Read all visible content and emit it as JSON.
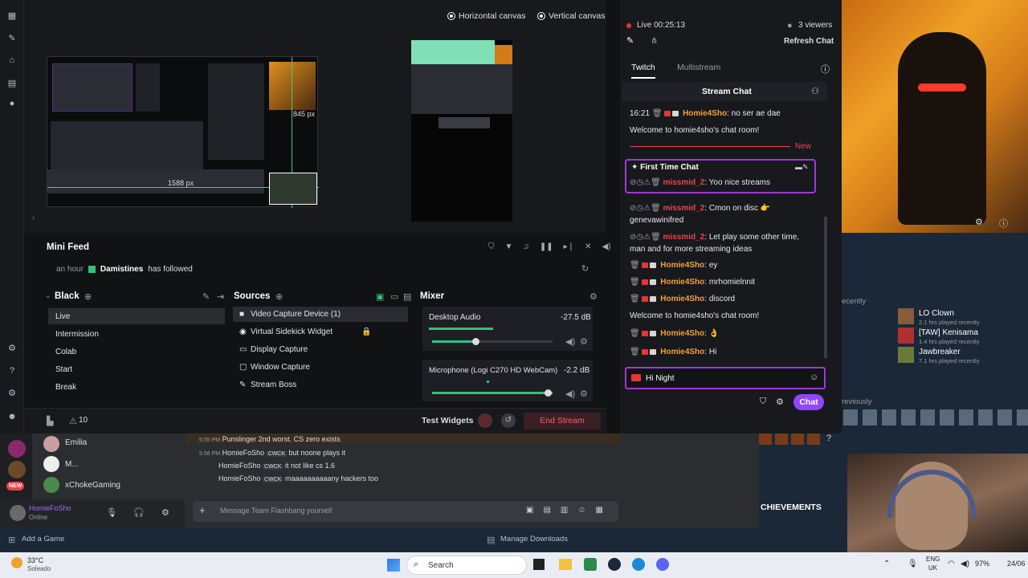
{
  "preview": {
    "canvas_horizontal": "Horizontal canvas",
    "canvas_vertical": "Vertical canvas",
    "measure_h": "845 px",
    "measure_w": "1588 px"
  },
  "minifeed": {
    "title": "Mini Feed",
    "time": "an hour",
    "user": "Damistines",
    "action": "has followed"
  },
  "scenes": {
    "title": "Black",
    "items": [
      "Live",
      "Intermission",
      "Colab",
      "Start",
      "Break"
    ]
  },
  "sources": {
    "title": "Sources",
    "items": [
      "Video Capture Device (1)",
      "Virtual Sidekick Widget",
      "Display Capture",
      "Window Capture",
      "Stream Boss"
    ]
  },
  "mixer": {
    "title": "Mixer",
    "channels": [
      {
        "name": "Desktop Audio",
        "db": "-27.5 dB",
        "level": 0.55
      },
      {
        "name": "Microphone (Logi C270 HD WebCam)",
        "db": "-2.2 dB",
        "level": 0.05
      }
    ]
  },
  "statusbar": {
    "alerts": "10",
    "test_widgets": "Test Widgets",
    "end_stream": "End Stream"
  },
  "chat": {
    "live_time": "Live 00:25:13",
    "viewers": "3 viewers",
    "refresh": "Refresh Chat",
    "tabs": [
      "Twitch",
      "Multistream"
    ],
    "header": "Stream Chat",
    "new_label": "New",
    "first_time_label": "First Time Chat",
    "input_value": "Hi Night",
    "send_label": "Chat",
    "messages": [
      {
        "time": "16:21",
        "user": "Homie4Sho",
        "text": "no ser ae dae"
      },
      {
        "system": "Welcome to homie4sho's chat room!"
      },
      {
        "user": "missmid_2",
        "text": "Yoo nice streams"
      },
      {
        "user": "missmid_2",
        "text": "Cmon on disc 👉 genevawinifred"
      },
      {
        "user": "missmid_2",
        "text": "Let play some other time, man and for more streaming ideas"
      },
      {
        "user": "Homie4Sho",
        "text": "ey"
      },
      {
        "user": "Homie4Sho",
        "text": "mrhomielnnit"
      },
      {
        "user": "Homie4Sho",
        "text": "discord"
      },
      {
        "system": "Welcome to homie4sho's chat room!"
      },
      {
        "user": "Homie4Sho",
        "text": "👌"
      },
      {
        "user": "Homie4Sho",
        "text": "Hi"
      }
    ]
  },
  "steam_panel": {
    "recently_label": "ecently",
    "previously_label": "reviously",
    "achievements": "CHIEVEMENTS",
    "friends": [
      {
        "name": "LO Clown",
        "sub": "2.1 hrs played recently"
      },
      {
        "name": "[TAW] Kenisama",
        "sub": "1.4 hrs played recently"
      },
      {
        "name": "Jawbreaker",
        "sub": "7.1 hrs played recently"
      }
    ]
  },
  "discord": {
    "members": [
      "Emilia",
      "M...",
      "xChokeGaming"
    ],
    "new_badge": "NEW",
    "user_name": "HomieFoSho",
    "user_status": "Online",
    "messages": [
      {
        "time": "5:55 PM",
        "user": "Punslinger",
        "text": "2nd worst. CS zero exists"
      },
      {
        "time": "5:56 PM",
        "user": "HomieFoSho",
        "tag": "CWCK",
        "text": "but noone plays it"
      },
      {
        "user": "HomieFoSho",
        "tag": "CWCK",
        "text": "it not like cs 1.6"
      },
      {
        "user": "HomieFoSho",
        "tag": "CWCK",
        "text": "maaaaaaaaaany hackers too"
      }
    ],
    "input_placeholder": "Message Team Flashbang yourself"
  },
  "steam_footer": {
    "add_game": "Add a Game",
    "downloads": "Manage Downloads"
  },
  "taskbar": {
    "weather_temp": "33°C",
    "weather_desc": "Soleado",
    "search": "Search",
    "lang": "ENG",
    "region": "UK",
    "battery": "97%",
    "date": "24/06"
  }
}
